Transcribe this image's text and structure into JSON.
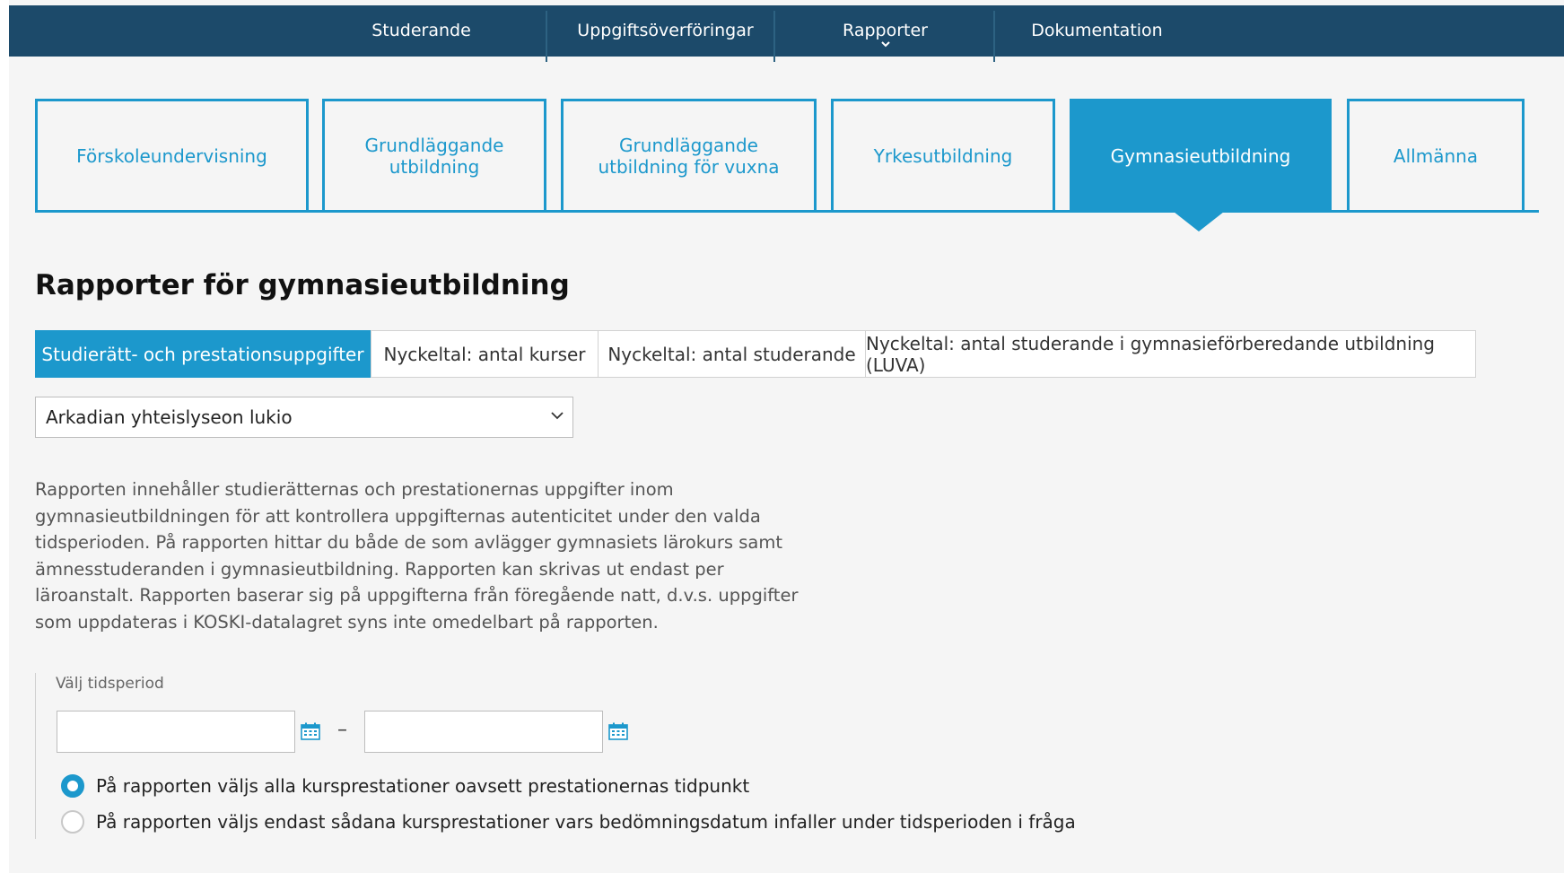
{
  "topnav": {
    "items": [
      {
        "label": "Studerande"
      },
      {
        "label": "Uppgiftsöverföringar"
      },
      {
        "label": "Rapporter"
      },
      {
        "label": "Dokumentation"
      }
    ]
  },
  "education_tabs": [
    {
      "label": "Förskoleundervisning",
      "active": false
    },
    {
      "label": "Grundläggande utbildning",
      "active": false
    },
    {
      "label": "Grundläggande utbildning för vuxna",
      "active": false
    },
    {
      "label": "Yrkesutbildning",
      "active": false
    },
    {
      "label": "Gymnasieutbildning",
      "active": true
    },
    {
      "label": "Allmänna",
      "active": false
    }
  ],
  "page_title": "Rapporter för gymnasieutbildning",
  "report_tabs": [
    {
      "label": "Studierätt- och prestationsuppgifter",
      "active": true
    },
    {
      "label": "Nyckeltal: antal kurser",
      "active": false
    },
    {
      "label": "Nyckeltal: antal studerande",
      "active": false
    },
    {
      "label": "Nyckeltal: antal studerande i gymnasieförberedande utbildning (LUVA)",
      "active": false
    }
  ],
  "institution_select": {
    "value": "Arkadian yhteislyseon lukio"
  },
  "description": "Rapporten innehåller studierätternas och prestationernas uppgifter inom gymnasieutbildningen för att kontrollera uppgifternas autenticitet under den valda tidsperioden. På rapporten hittar du både de som avlägger gymnasiets lärokurs samt ämnesstuderanden i gymnasieutbildning. Rapporten kan skrivas ut endast per läroanstalt. Rapporten baserar sig på uppgifterna från föregående natt, d.v.s. uppgifter som uppdateras i KOSKI-datalagret syns inte omedelbart på rapporten.",
  "period": {
    "label": "Välj tidsperiod",
    "start_value": "",
    "end_value": "",
    "separator": "–"
  },
  "options": [
    {
      "label": "På rapporten väljs alla kursprestationer oavsett prestationernas tidpunkt",
      "checked": true
    },
    {
      "label": "På rapporten väljs endast sådana kursprestationer vars bedömningsdatum infaller under tidsperioden i fråga",
      "checked": false
    }
  ],
  "colors": {
    "accent": "#1c98cc",
    "nav": "#1c4a6a"
  }
}
